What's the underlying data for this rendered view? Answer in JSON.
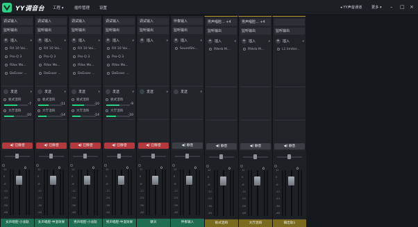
{
  "app": {
    "brand": "YY调音台",
    "accent": "#2bd184"
  },
  "menu": [
    "工程 ▾",
    "插件管理",
    "设置"
  ],
  "right": {
    "mic_label": "YY声音通道",
    "more_label": "更多 ▾",
    "minimize": "–",
    "maximize": "□",
    "close": "×"
  },
  "labels": {
    "add": "插入",
    "send": "发送",
    "reverb_small": "板式混响",
    "reverb_large": "大厅混响"
  },
  "channels": [
    {
      "header": "调试输入",
      "output": "监听输出",
      "plugins": [
        "RX 10 Voi...",
        "Pro-Q 3",
        "RVox Mo...",
        "DeEsser ..."
      ],
      "sends": [
        "-7",
        "-10"
      ],
      "send_fill": [
        0.55,
        0.4
      ],
      "mute_label": "已静音",
      "muted": true,
      "volume": "0",
      "fader": 0.78,
      "name": "女声唱腔-小总轨",
      "name_color": "#1f6e52"
    },
    {
      "header": "调试输入",
      "output": "监听输出",
      "plugins": [
        "RX 10 Voi...",
        "Pro-Q 3",
        "RVox Mo...",
        "DeEsser ..."
      ],
      "sends": [
        "-11",
        "-14"
      ],
      "send_fill": [
        0.45,
        0.35
      ],
      "mute_label": "已静音",
      "muted": true,
      "volume": "0",
      "fader": 0.78,
      "name": "女声唱腔-中混效果",
      "name_color": "#1f6e52"
    },
    {
      "header": "调试输入",
      "output": "监听输出",
      "plugins": [
        "RX 10 Voi...",
        "Pro-Q 3",
        "RVox Mo...",
        "DeEsser ..."
      ],
      "sends": [
        "-10",
        "-14"
      ],
      "send_fill": [
        0.5,
        0.35
      ],
      "mute_label": "已静音",
      "muted": true,
      "volume": "0",
      "fader": 0.78,
      "name": "男声唱腔-小总轨",
      "name_color": "#1f6e52"
    },
    {
      "header": "调试输入",
      "output": "监听输出",
      "plugins": [
        "RX 10 Voi...",
        "Pro-Q 3",
        "RVox Mo...",
        "DeEsser ..."
      ],
      "sends": [
        "-9",
        "-10"
      ],
      "send_fill": [
        0.55,
        0.4
      ],
      "mute_label": "已静音",
      "muted": true,
      "volume": "0",
      "fader": 0.78,
      "name": "男声唱腔-中混效果",
      "name_color": "#1f6e52"
    },
    {
      "header": "调试输入",
      "output": "监听输出",
      "plugins": [],
      "sends": [],
      "send_fill": [],
      "mute_label": "已静音",
      "muted": true,
      "volume": "0",
      "fader": 0.78,
      "name": "聊天",
      "name_color": "#1f6e52"
    },
    {
      "header": "伴奏输入",
      "output": "监听输出",
      "plugins": [
        "SoundShi..."
      ],
      "sends": [],
      "send_fill": [],
      "mute_label": "静音",
      "muted": false,
      "volume": "0",
      "fader": 0.78,
      "name": "伴奏输入",
      "name_color": "#1f6e52"
    },
    {
      "header": "男声唱腔... +4",
      "output": "监听输出",
      "plugins": [
        "RVerb M..."
      ],
      "sends": [],
      "send_fill": [],
      "mute_label": "静音",
      "muted": false,
      "volume": "0",
      "fader": 0.78,
      "name": "板式混响",
      "name_color": "#7a6a1e"
    },
    {
      "header": "男声唱腔... +4",
      "output": "监听输出",
      "plugins": [
        "RVerb M..."
      ],
      "sends": [],
      "send_fill": [],
      "mute_label": "静音",
      "muted": false,
      "volume": "0",
      "fader": 0.78,
      "name": "大厅混响",
      "name_color": "#7a6a1e"
    },
    {
      "header": "",
      "output": "监听输出",
      "plugins": [
        "L1 limiter..."
      ],
      "sends": [],
      "send_fill": [],
      "mute_label": "静音",
      "muted": false,
      "volume": "0",
      "fader": 0.78,
      "name": "输出轨1",
      "name_color": "#7a6a1e"
    }
  ],
  "scale": [
    "12",
    "0",
    "-6",
    "-12",
    "-24",
    "-36",
    "-48"
  ]
}
